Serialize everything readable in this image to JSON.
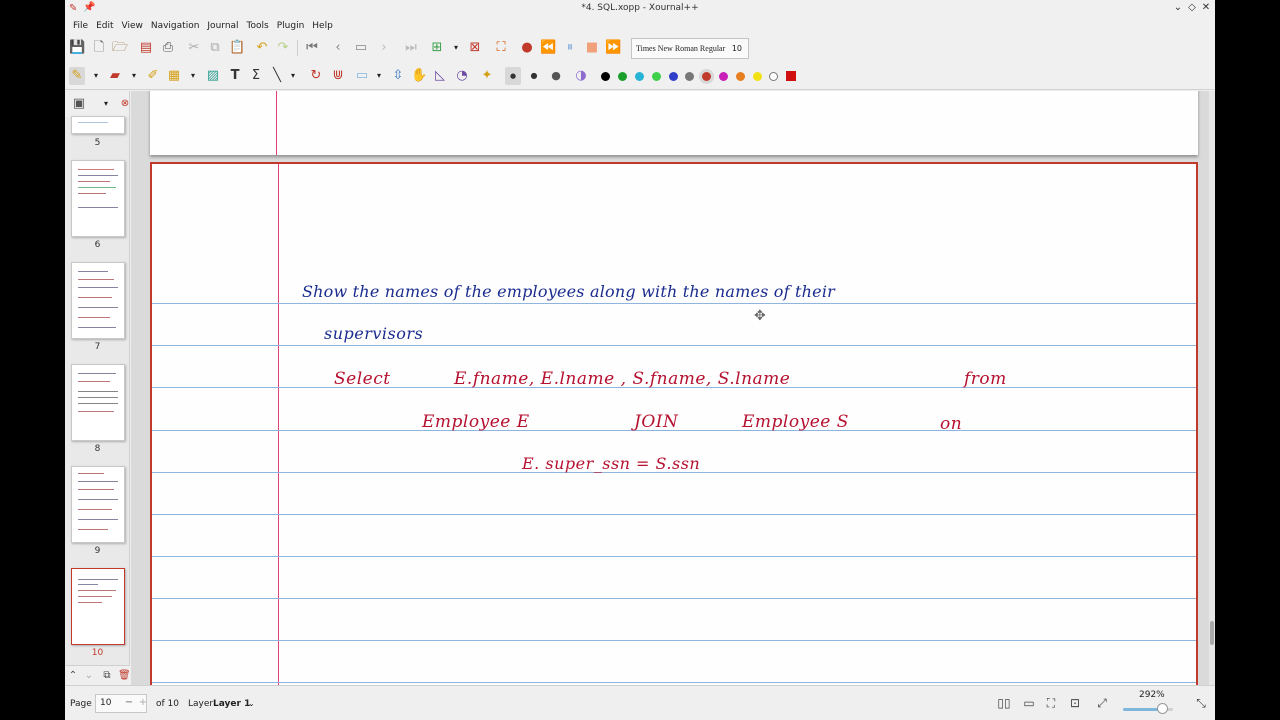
{
  "window": {
    "title": "*4. SQL.xopp - Xournal++"
  },
  "menu": [
    "File",
    "Edit",
    "View",
    "Navigation",
    "Journal",
    "Tools",
    "Plugin",
    "Help"
  ],
  "toolbar": {
    "font_name": "Times New Roman Regular",
    "font_size": "10"
  },
  "colors": {
    "palette": [
      "#000000",
      "#1a9e2c",
      "#27b3d6",
      "#3fd04a",
      "#2f3fc9",
      "#777777",
      "#c0392b",
      "#c71fb8",
      "#e67e22",
      "#f1e013",
      "#ffffff"
    ],
    "current": "#d01010",
    "ink_blue": "#1b2c8f",
    "ink_red": "#b5102f",
    "accent": "#c0392b"
  },
  "sidebar": {
    "pages": [
      {
        "label": "5"
      },
      {
        "label": "6"
      },
      {
        "label": "7"
      },
      {
        "label": "8"
      },
      {
        "label": "9"
      },
      {
        "label": "10"
      }
    ]
  },
  "notes": {
    "line1": "Show  the  names  of  the  employees  along  with  the  names  of  their",
    "line2": "supervisors",
    "line3_a": "Select",
    "line3_b": "E.fname,  E.lname  ,  S.fname,  S.lname",
    "line3_c": "from",
    "line4_a": "Employee   E",
    "line4_b": "JOIN",
    "line4_c": "Employee  S",
    "line4_d": "on",
    "line5": "E. super_ssn   =   S.ssn"
  },
  "status": {
    "page_label": "Page",
    "page_value": "10",
    "of_pages": "of 10",
    "layer_label": "Layer",
    "layer_value": "Layer 1",
    "zoom": "292%",
    "zoom_level": 0.78
  }
}
